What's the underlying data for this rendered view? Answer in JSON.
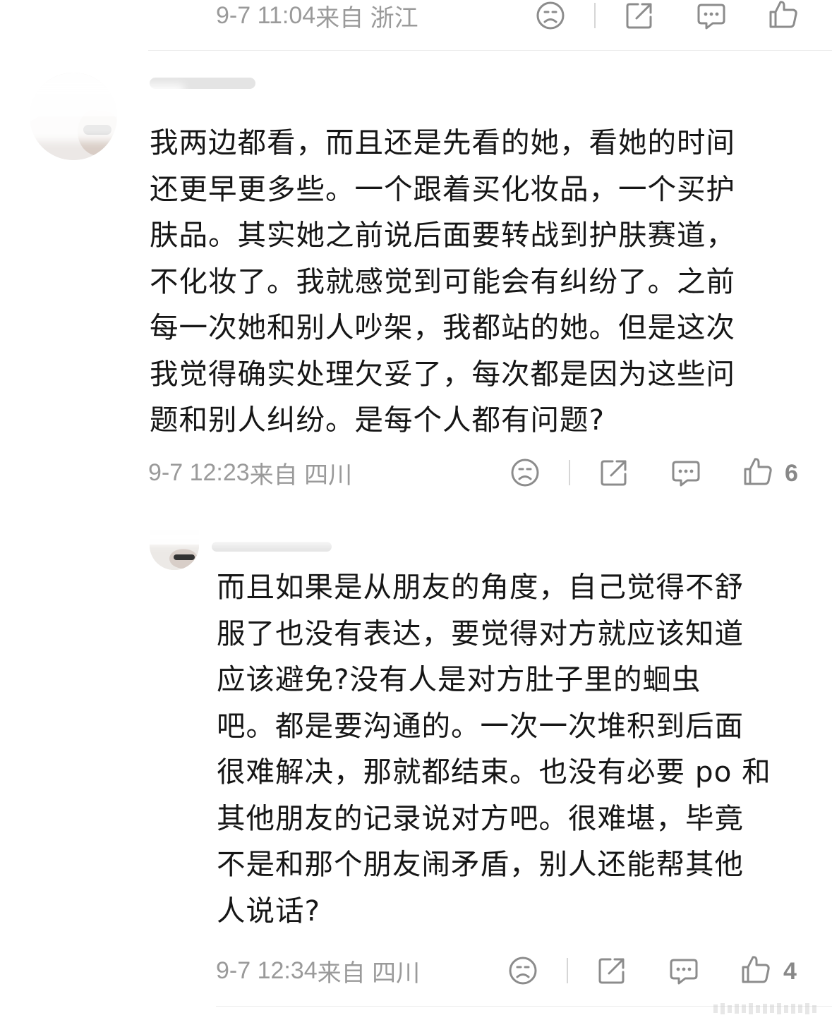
{
  "comments": [
    {
      "meta_time": "9-7 11:04",
      "meta_location": "来自 浙江",
      "like_count": ""
    },
    {
      "text": "我两边都看，而且还是先看的她，看她的时间\n还更早更多些。一个跟着买化妆品，一个买护\n肤品。其实她之前说后面要转战到护肤赛道，\n不化妆了。我就感觉到可能会有纠纷了。之前\n每一次她和别人吵架，我都站的她。但是这次\n我觉得确实处理欠妥了，每次都是因为这些问\n题和别人纠纷。是每个人都有问题?",
      "meta_time": "9-7 12:23",
      "meta_location": "来自 四川",
      "like_count": "6"
    },
    {
      "text": "而且如果是从朋友的角度，自己觉得不舒\n服了也没有表达，要觉得对方就应该知道\n应该避免?没有人是对方肚子里的蛔虫\n吧。都是要沟通的。一次一次堆积到后面\n很难解决，那就都结束。也没有必要 po 和\n其他朋友的记录说对方吧。很难堪，毕竟\n不是和那个朋友闹矛盾，别人还能帮其他\n人说话?",
      "meta_time": "9-7 12:34",
      "meta_location": "来自 四川",
      "like_count": "4"
    }
  ],
  "icons": {
    "sad": "sad-face-icon",
    "share": "share-icon",
    "reply": "comment-bubble-icon",
    "like": "thumbs-up-icon"
  },
  "colors": {
    "meta": "#9a9a9a",
    "icon": "#8c8c8c",
    "text": "#161616"
  }
}
